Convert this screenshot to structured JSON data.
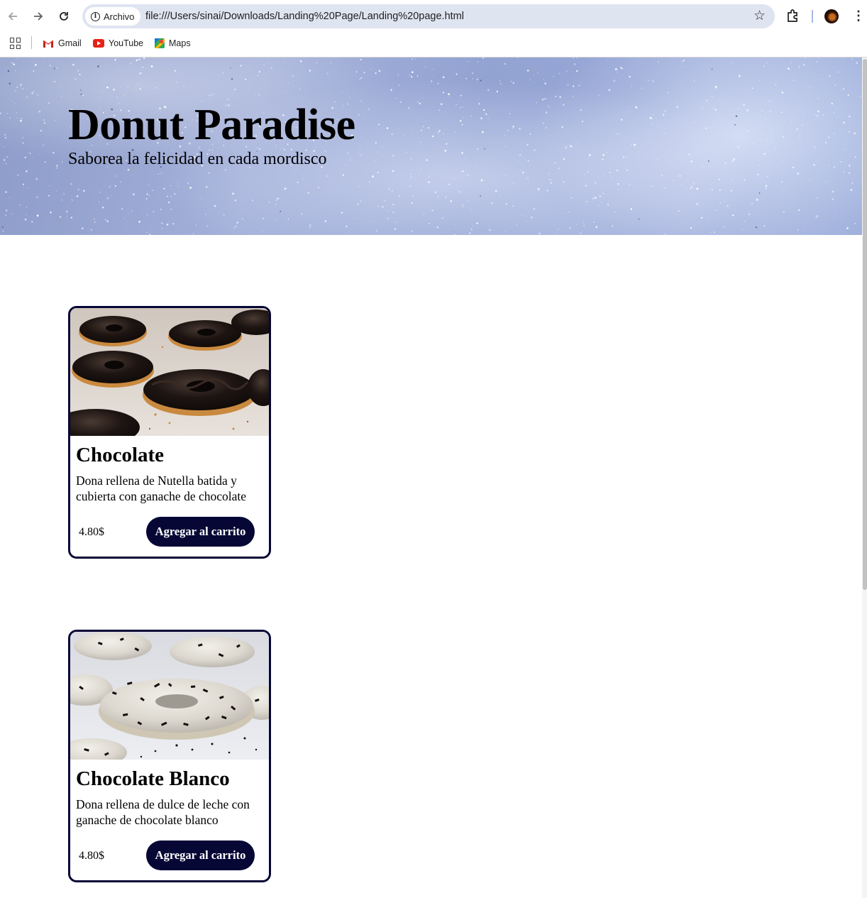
{
  "browser": {
    "site_chip_label": "Archivo",
    "url": "file:///Users/sinai/Downloads/Landing%20Page/Landing%20page.html",
    "bookmarks": [
      {
        "label": "Gmail",
        "icon": "gmail-icon"
      },
      {
        "label": "YouTube",
        "icon": "youtube-icon"
      },
      {
        "label": "Maps",
        "icon": "maps-icon"
      }
    ]
  },
  "hero": {
    "title": "Donut Paradise",
    "subtitle": "Saborea la felicidad en cada mordisco"
  },
  "products": [
    {
      "name": "Chocolate",
      "description": "Dona rellena de Nutella batida y cubierta con ganache de chocolate",
      "price": "4.80$",
      "button_label": "Agregar al carrito"
    },
    {
      "name": "Chocolate Blanco",
      "description": "Dona rellena de dulce de leche con ganache de chocolate blanco",
      "price": "4.80$",
      "button_label": "Agregar al carrito"
    }
  ],
  "colors": {
    "accent": "#070736",
    "omnibox": "#dfe4f1",
    "hero_base": "#9aa8d4"
  }
}
